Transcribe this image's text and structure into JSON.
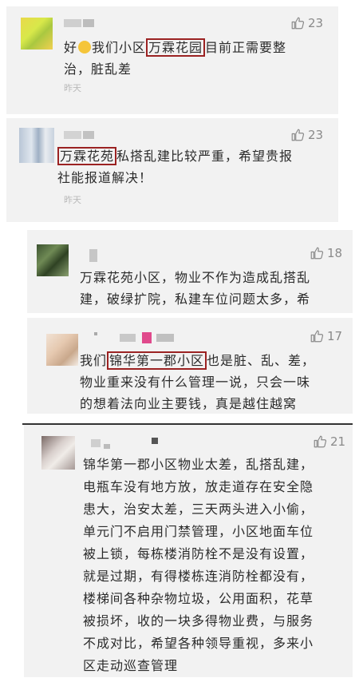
{
  "comments": [
    {
      "likes": "23",
      "prefix": "好",
      "line1_a": "我们小区",
      "line1_hl": "万霖花园",
      "line1_b": "目前正需要整",
      "line2": "治，脏乱差",
      "time": "昨天"
    },
    {
      "likes": "23",
      "line1_hl": "万霖花苑",
      "line1_b": "私搭乱建比较严重，希望贵报",
      "line2": "社能报道解决！",
      "time": "昨天"
    },
    {
      "likes": "18",
      "line1": "万霖花苑小区，物业不作为造成乱搭乱",
      "line2": "建，破绿扩院，私建车位问题太多，希"
    },
    {
      "likes": "17",
      "line1_a": "我们",
      "line1_hl": "锦华第一郡小区",
      "line1_b": "也是脏、乱、差，",
      "line2": "物业重来没有什么管理一说，只会一味",
      "line3": "的想着法向业主要钱，真是越住越窝"
    },
    {
      "likes": "21",
      "lines": [
        "锦华第一郡小区物业太差，乱搭乱建，",
        "电瓶车没有地方放，放走道存在安全隐",
        "患大，治安太差，三天两头进入小偷，",
        "单元门不启用门禁管理，小区地面车位",
        "被上锁，每栋楼消防栓不是没有设置，",
        "就是过期，有得楼栋连消防栓都没有，",
        "楼梯间各种杂物垃圾，公用面积，花草",
        "被损坏，收的一块多得物业费，与服务",
        "不成对比，希望各种领导重视，多来小",
        "区走动巡查管理"
      ]
    }
  ],
  "colors": {
    "highlight_border": "#9b2222",
    "card_bg": "#f2f2f2",
    "like_text": "#8a8a8a"
  }
}
